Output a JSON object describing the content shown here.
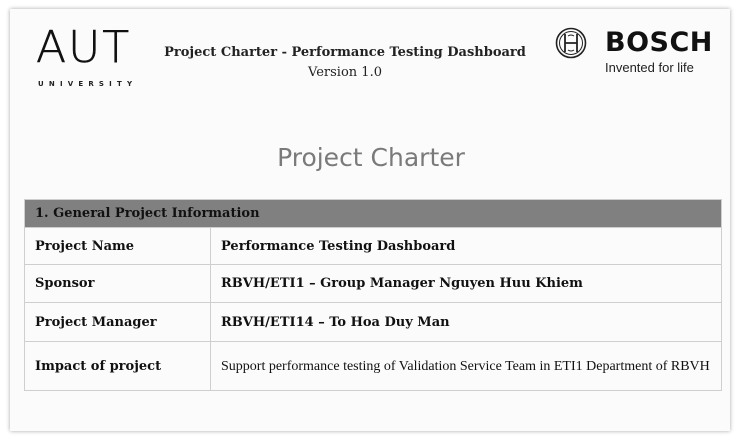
{
  "header": {
    "left_logo": {
      "text": "AUT",
      "subtext": "UNIVERSITY"
    },
    "title": "Project Charter - Performance Testing Dashboard",
    "version": "Version 1.0",
    "right_logo": {
      "text": "BOSCH",
      "tagline": "Invented for life"
    }
  },
  "page_heading": "Project Charter",
  "section": {
    "heading": "1.   General Project Information",
    "rows": [
      {
        "label": "Project Name",
        "value": "Performance Testing Dashboard"
      },
      {
        "label": "Sponsor",
        "value": "RBVH/ETI1 – Group Manager Nguyen Huu Khiem"
      },
      {
        "label": "Project Manager",
        "value": "RBVH/ETI14 – To Hoa Duy Man"
      },
      {
        "label": "Impact of project",
        "value": "Support performance testing of Validation Service Team in ETI1 Department of RBVH"
      }
    ]
  },
  "colors": {
    "section_header_bg": "#808080",
    "heading_gray": "#7a7a7a"
  }
}
